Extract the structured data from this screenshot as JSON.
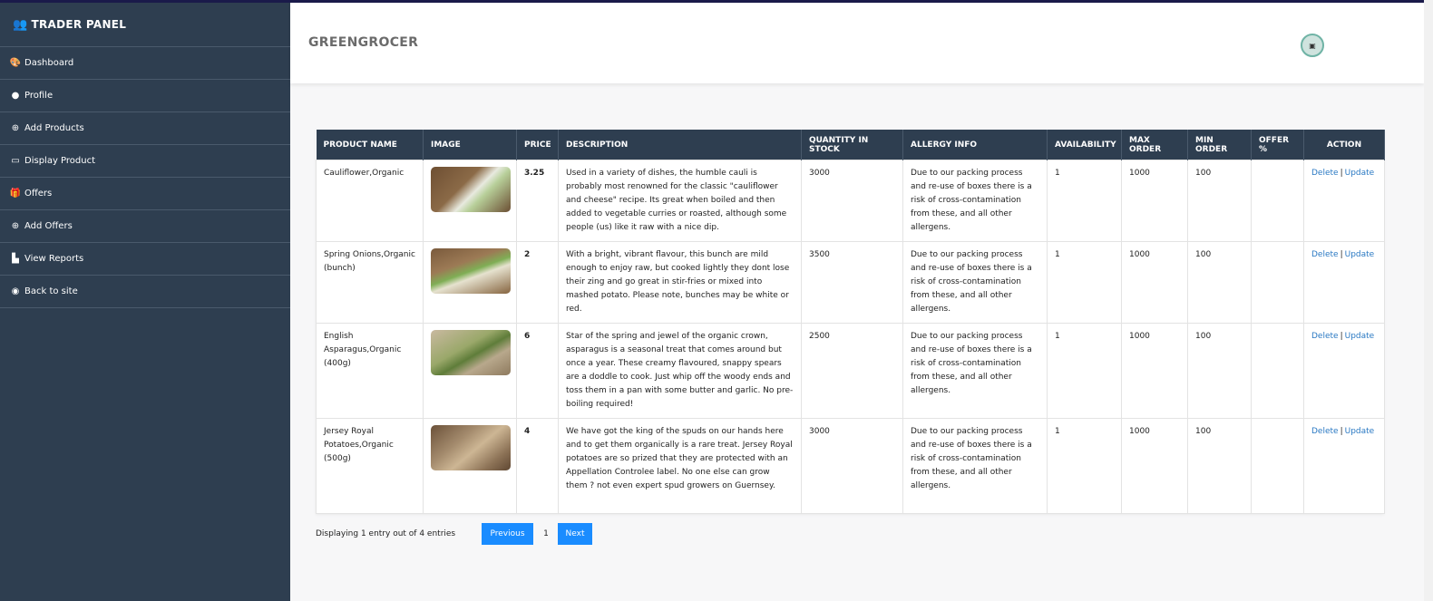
{
  "sidebar": {
    "brand": "TRADER PANEL",
    "items": [
      {
        "label": "Dashboard",
        "icon": "🎨"
      },
      {
        "label": "Profile",
        "icon": "●"
      },
      {
        "label": "Add Products",
        "icon": "⊕"
      },
      {
        "label": "Display Product",
        "icon": "▭"
      },
      {
        "label": "Offers",
        "icon": "🎁"
      },
      {
        "label": "Add Offers",
        "icon": "⊕"
      },
      {
        "label": "View Reports",
        "icon": "▙"
      },
      {
        "label": "Back to site",
        "icon": "◉"
      }
    ]
  },
  "header": {
    "title": "GREENGROCER"
  },
  "table": {
    "columns": [
      "PRODUCT NAME",
      "IMAGE",
      "PRICE",
      "DESCRIPTION",
      "QUANTITY IN STOCK",
      "ALLERGY INFO",
      "AVAILABILITY",
      "MAX ORDER",
      "MIN ORDER",
      "OFFER %",
      "ACTION"
    ],
    "rows": [
      {
        "name": "Cauliflower,Organic",
        "price": "3.25",
        "description": "Used in a variety of dishes, the humble cauli is probably most renowned for the classic \"cauliflower and cheese\" recipe. Its great when boiled and then added to vegetable curries or roasted, although some people (us) like it raw with a nice dip.",
        "quantity": "3000",
        "allergy": "Due to our packing process and re-use of boxes there is a risk of cross-contamination from these, and all other allergens.",
        "availability": "1",
        "max_order": "1000",
        "min_order": "100",
        "offer": "",
        "delete": "Delete",
        "sep": "|",
        "update": "Update"
      },
      {
        "name": "Spring Onions,Organic (bunch)",
        "price": "2",
        "description": "With a bright, vibrant flavour, this bunch are mild enough to enjoy raw, but cooked lightly they dont lose their zing and go great in stir-fries or mixed into mashed potato. Please note, bunches may be white or red.",
        "quantity": "3500",
        "allergy": "Due to our packing process and re-use of boxes there is a risk of cross-contamination from these, and all other allergens.",
        "availability": "1",
        "max_order": "1000",
        "min_order": "100",
        "offer": "",
        "delete": "Delete",
        "sep": "|",
        "update": "Update"
      },
      {
        "name": "English Asparagus,Organic (400g)",
        "price": "6",
        "description": "Star of the spring and jewel of the organic crown, asparagus is a seasonal treat that comes around but once a year. These creamy flavoured, snappy spears are a doddle to cook. Just whip off the woody ends and toss them in a pan with some butter and garlic. No pre-boiling required!",
        "quantity": "2500",
        "allergy": "Due to our packing process and re-use of boxes there is a risk of cross-contamination from these, and all other allergens.",
        "availability": "1",
        "max_order": "1000",
        "min_order": "100",
        "offer": "",
        "delete": "Delete",
        "sep": "|",
        "update": "Update"
      },
      {
        "name": "Jersey Royal Potatoes,Organic (500g)",
        "price": "4",
        "description": "We have got the king of the spuds on our hands here and to get them organically is a rare treat. Jersey Royal potatoes are so prized that they are protected with an Appellation Controlee label. No one else can grow them ? not even expert spud growers on Guernsey.",
        "quantity": "3000",
        "allergy": "Due to our packing process and re-use of boxes there is a risk of cross-contamination from these, and all other allergens.",
        "availability": "1",
        "max_order": "1000",
        "min_order": "100",
        "offer": "",
        "delete": "Delete",
        "sep": "|",
        "update": "Update"
      }
    ]
  },
  "pagination": {
    "info": "Displaying 1 entry out of 4 entries",
    "previous": "Previous",
    "page": "1",
    "next": "Next"
  }
}
